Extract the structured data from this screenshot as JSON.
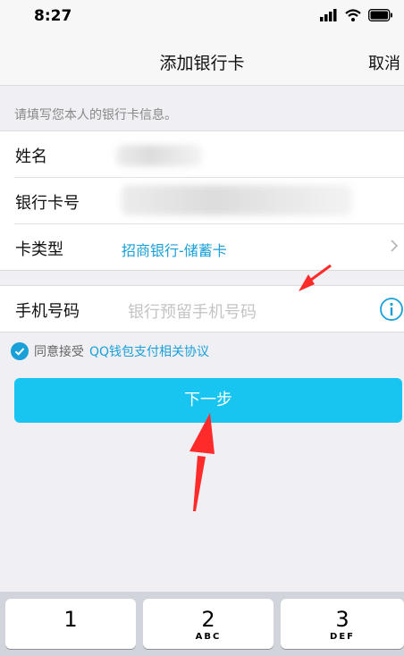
{
  "status_bar": {
    "time": "8:27"
  },
  "nav": {
    "title": "添加银行卡",
    "cancel_label": "取消"
  },
  "form": {
    "hint": "请填写您本人的银行卡信息。",
    "name_label": "姓名",
    "card_number_label": "银行卡号",
    "card_type_label": "卡类型",
    "card_type_value": "招商银行-储蓄卡",
    "phone_label": "手机号码",
    "phone_placeholder": "银行预留手机号码"
  },
  "agreement": {
    "checked": true,
    "prefix": "同意接受",
    "link_text": "QQ钱包支付相关协议"
  },
  "next_button": {
    "label": "下一步"
  },
  "keyboard": {
    "keys": [
      {
        "number": "1",
        "letters": ""
      },
      {
        "number": "2",
        "letters": "ABC"
      },
      {
        "number": "3",
        "letters": "DEF"
      }
    ]
  },
  "colors": {
    "accent": "#19a0d9",
    "button": "#18c5f0",
    "annotation_arrow": "#ff2a2a"
  }
}
